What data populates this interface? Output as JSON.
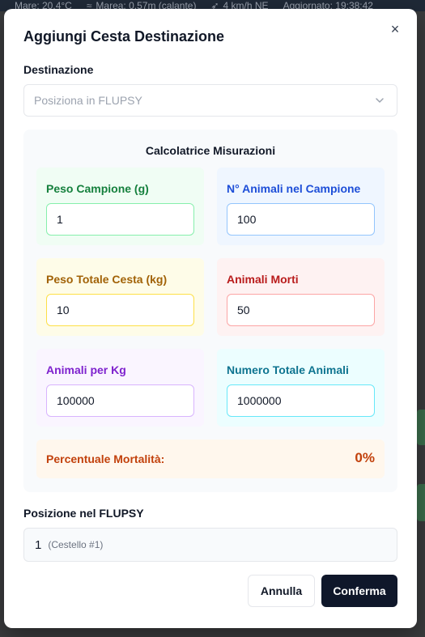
{
  "background": {
    "topbar": {
      "temperature": "Mare: 20.4°C",
      "tide": "Marea: 0.57m (calante)",
      "wind": "4 km/h NE",
      "updated": "Aggiornato: 19:38:42"
    }
  },
  "modal": {
    "title": "Aggiungi Cesta Destinazione",
    "close_label": "×",
    "destination": {
      "label": "Destinazione",
      "selected": "Posiziona in FLUPSY"
    },
    "calculator": {
      "title": "Calcolatrice Misurazioni",
      "sample_weight": {
        "label": "Peso Campione (g)",
        "value": "1"
      },
      "sample_animals": {
        "label": "N° Animali nel Campione",
        "value": "100"
      },
      "basket_weight": {
        "label": "Peso Totale Cesta (kg)",
        "value": "10"
      },
      "dead_animals": {
        "label": "Animali Morti",
        "value": "50"
      },
      "animals_per_kg": {
        "label": "Animali per Kg",
        "value": "100000"
      },
      "total_animals": {
        "label": "Numero Totale Animali",
        "value": "1000000"
      },
      "mortality": {
        "label": "Percentuale Mortalità:",
        "value": "0%"
      }
    },
    "position": {
      "label": "Posizione nel FLUPSY",
      "value": "1",
      "detail": "(Cestello #1)"
    },
    "buttons": {
      "cancel": "Annulla",
      "confirm": "Conferma"
    }
  },
  "colors": {
    "green": "#15803d",
    "blue": "#1d4ed8",
    "yellow": "#a16207",
    "red": "#b91c1c",
    "purple": "#7e22ce",
    "cyan": "#0e7490",
    "orange": "#c2410c",
    "primary_button": "#0f172a"
  }
}
